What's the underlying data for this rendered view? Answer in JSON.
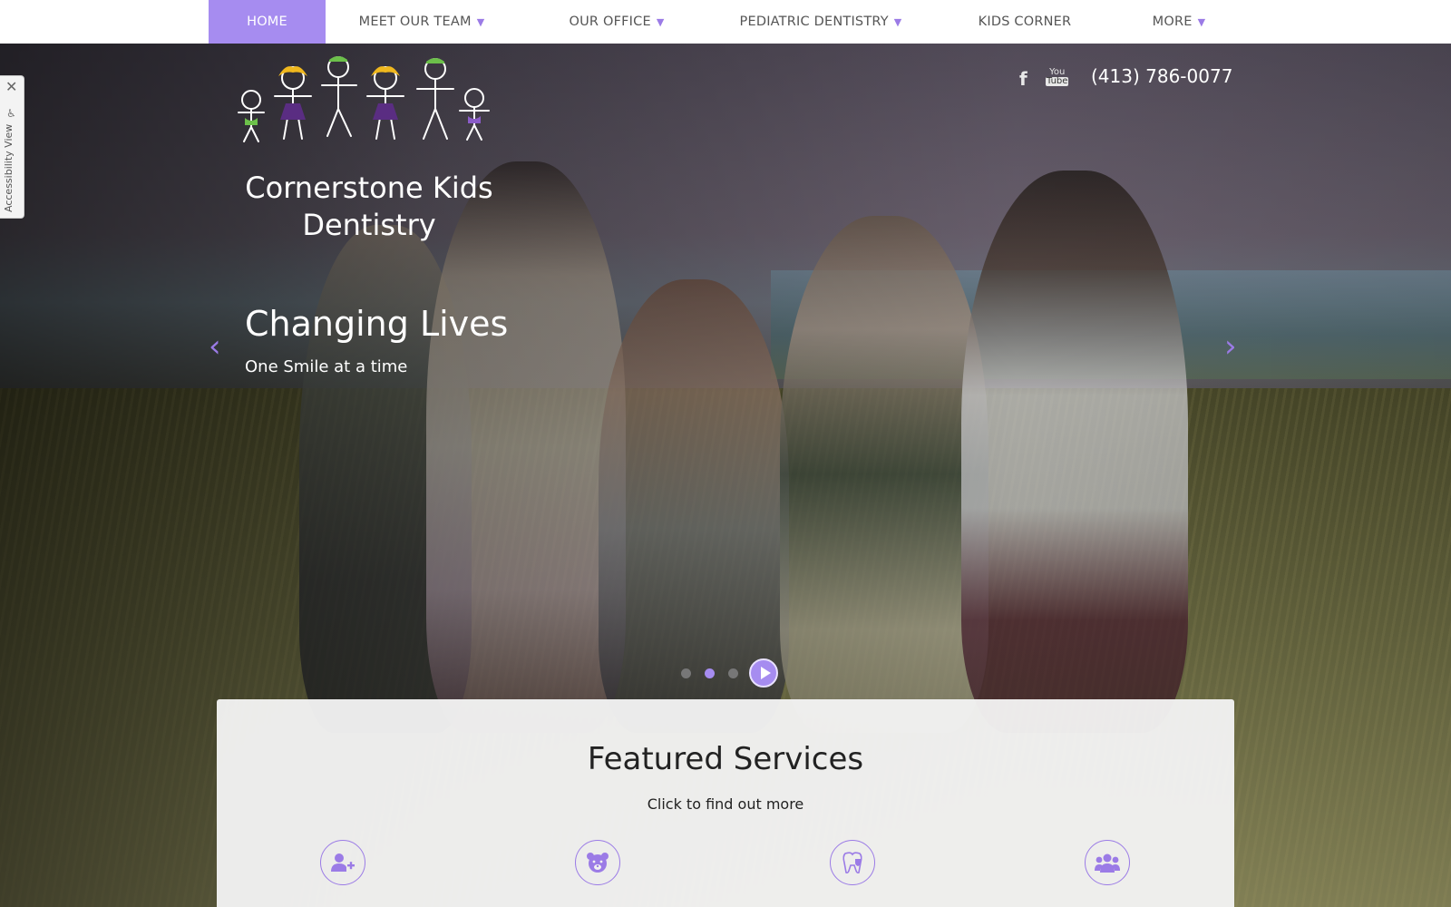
{
  "nav": {
    "items": [
      {
        "label": "HOME",
        "active": true,
        "has_dropdown": false
      },
      {
        "label": "MEET OUR TEAM",
        "active": false,
        "has_dropdown": true
      },
      {
        "label": "OUR OFFICE",
        "active": false,
        "has_dropdown": true
      },
      {
        "label": "PEDIATRIC DENTISTRY",
        "active": false,
        "has_dropdown": true
      },
      {
        "label": "KIDS CORNER",
        "active": false,
        "has_dropdown": false
      },
      {
        "label": "MORE",
        "active": false,
        "has_dropdown": true
      }
    ],
    "caret": "▼"
  },
  "accessibility": {
    "label": "Accessibility View",
    "close": "✕",
    "icon": "wheelchair-icon"
  },
  "brand": {
    "name": "Cornerstone Kids Dentistry"
  },
  "header": {
    "social": [
      {
        "icon": "facebook-icon",
        "glyph": "f"
      },
      {
        "icon": "youtube-icon",
        "glyph_top": "You",
        "glyph_bottom": "Tube"
      }
    ],
    "phone": "(413) 786-0077"
  },
  "slider": {
    "title": "Changing Lives",
    "subtitle": "One Smile at a time",
    "prev": "‹",
    "next": "›",
    "dots": 3,
    "active_dot": 2
  },
  "featured": {
    "title": "Featured Services",
    "subtitle": "Click to find out more",
    "services": [
      {
        "icon": "add-user-icon"
      },
      {
        "icon": "bear-icon"
      },
      {
        "icon": "tooth-shield-icon"
      },
      {
        "icon": "users-group-icon"
      }
    ]
  },
  "colors": {
    "accent": "#a68cf0",
    "accent_dark": "#9b7be6",
    "nav_text": "#555555"
  }
}
